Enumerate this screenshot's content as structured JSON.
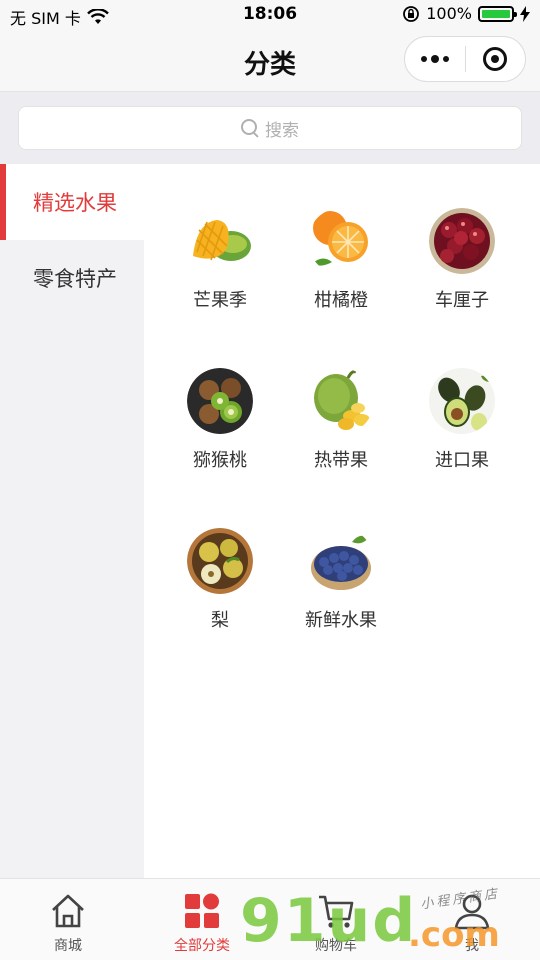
{
  "status_bar": {
    "carrier": "无 SIM 卡",
    "time": "18:06",
    "battery_pct": "100%",
    "battery_level": 1.0,
    "icons": [
      "wifi-icon",
      "orientation-lock-icon",
      "battery-icon",
      "charging-icon"
    ]
  },
  "nav": {
    "title": "分类",
    "capsule_icons": [
      "more-dots-icon",
      "close-target-icon"
    ]
  },
  "search": {
    "placeholder": "搜索"
  },
  "sidebar": {
    "items": [
      {
        "label": "精选水果",
        "active": true
      },
      {
        "label": "零食特产",
        "active": false
      }
    ]
  },
  "categories": [
    {
      "label": "芒果季",
      "icon": "mango-icon"
    },
    {
      "label": "柑橘橙",
      "icon": "orange-icon"
    },
    {
      "label": "车厘子",
      "icon": "cherry-icon"
    },
    {
      "label": "猕猴桃",
      "icon": "kiwi-icon"
    },
    {
      "label": "热带果",
      "icon": "jackfruit-icon"
    },
    {
      "label": "进口果",
      "icon": "avocado-icon"
    },
    {
      "label": "梨",
      "icon": "pear-icon"
    },
    {
      "label": "新鲜水果",
      "icon": "blueberry-icon"
    }
  ],
  "tabbar": {
    "tabs": [
      {
        "label": "商城",
        "icon": "home-icon",
        "active": false
      },
      {
        "label": "全部分类",
        "icon": "category-grid-icon",
        "active": true
      },
      {
        "label": "购物车",
        "icon": "cart-icon",
        "active": false
      },
      {
        "label": "我",
        "icon": "user-icon",
        "active": false
      }
    ]
  },
  "watermark": {
    "brand": "91ud",
    "tld": ".com",
    "tagline": "小程序商店"
  },
  "colors": {
    "accent": "#e23b3b",
    "sidebar_bg": "#f2f2f4",
    "search_area_bg": "#ededf1"
  }
}
